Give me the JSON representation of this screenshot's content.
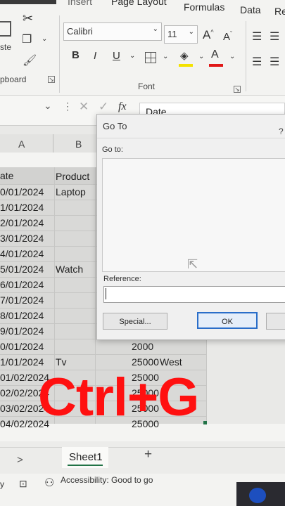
{
  "ribbon": {
    "tabs": [
      "Insert",
      "Page Layout",
      "Formulas",
      "Data",
      "Re"
    ],
    "clipboard_group": "pboard",
    "paste_partial": "ste",
    "font_group": "Font",
    "font_name": "Calibri",
    "font_size": "11",
    "bold": "B",
    "italic": "I",
    "underline": "U",
    "grow_font": "A",
    "shrink_font": "A",
    "font_color_letter": "A"
  },
  "formula_bar": {
    "fx": "fx",
    "value": "Date"
  },
  "grid": {
    "col_a": "A",
    "col_b": "B",
    "header_date": "ate",
    "header_product": "Product",
    "rows": [
      {
        "date": "0/01/2024",
        "product": "Laptop",
        "amount": "",
        "region": ""
      },
      {
        "date": "1/01/2024",
        "product": "",
        "amount": "",
        "region": ""
      },
      {
        "date": "2/01/2024",
        "product": "",
        "amount": "",
        "region": ""
      },
      {
        "date": "3/01/2024",
        "product": "",
        "amount": "",
        "region": ""
      },
      {
        "date": "4/01/2024",
        "product": "",
        "amount": "",
        "region": ""
      },
      {
        "date": "5/01/2024",
        "product": "Watch",
        "amount": "",
        "region": ""
      },
      {
        "date": "6/01/2024",
        "product": "",
        "amount": "",
        "region": ""
      },
      {
        "date": "7/01/2024",
        "product": "",
        "amount": "",
        "region": ""
      },
      {
        "date": "8/01/2024",
        "product": "",
        "amount": "",
        "region": ""
      },
      {
        "date": "9/01/2024",
        "product": "",
        "amount": "",
        "region": ""
      },
      {
        "date": "0/01/2024",
        "product": "",
        "amount": "2000",
        "region": ""
      },
      {
        "date": "1/01/2024",
        "product": "Tv",
        "amount": "25000",
        "region": "West"
      },
      {
        "date": "01/02/2024",
        "product": "",
        "amount": "25000",
        "region": ""
      },
      {
        "date": "02/02/2024",
        "product": "",
        "amount": "25000",
        "region": ""
      },
      {
        "date": "03/02/2024",
        "product": "",
        "amount": "25000",
        "region": ""
      },
      {
        "date": "04/02/2024",
        "product": "",
        "amount": "25000",
        "region": ""
      }
    ]
  },
  "dialog": {
    "title": "Go To",
    "help": "?",
    "goto_label": "Go to:",
    "reference_label": "Reference:",
    "reference_value": "",
    "special_button": "Special...",
    "ok_button": "OK"
  },
  "sheet_tabs": {
    "nav": ">",
    "active": "Sheet1",
    "add": "+"
  },
  "status": {
    "accessibility": "Accessibility: Good to go",
    "left_text": "y"
  },
  "overlay_text": "Ctrl+G"
}
